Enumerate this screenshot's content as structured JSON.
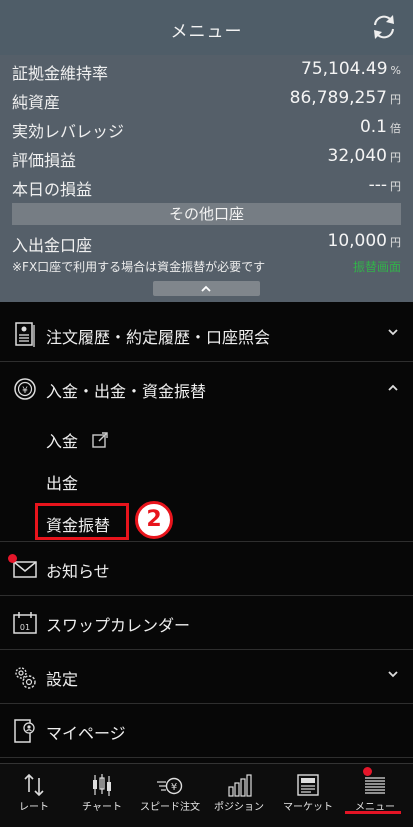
{
  "header": {
    "title": "メニュー",
    "refresh_icon": "refresh-icon"
  },
  "summary": {
    "rows": [
      {
        "label": "証拠金維持率",
        "value": "75,104.49",
        "unit": "%"
      },
      {
        "label": "純資産",
        "value": "86,789,257",
        "unit": "円"
      },
      {
        "label": "実効レバレッジ",
        "value": "0.1",
        "unit": "倍"
      },
      {
        "label": "評価損益",
        "value": "32,040",
        "unit": "円"
      },
      {
        "label": "本日の損益",
        "value": "---",
        "unit": "円"
      }
    ],
    "other_account_header": "その他口座",
    "deposit_account": {
      "label": "入出金口座",
      "value": "10,000",
      "unit": "円"
    },
    "note": "※FX口座で利用する場合は資金振替が必要です",
    "transfer_link": "振替画面",
    "collapse_icon": "chevron-up-icon"
  },
  "menu": {
    "items": [
      {
        "label": "注文履歴・約定履歴・口座照会",
        "icon": "document-list-icon"
      },
      {
        "label": "入金・出金・資金振替",
        "icon": "yen-coin-icon",
        "expanded": true
      },
      {
        "label": "お知らせ",
        "icon": "mail-icon",
        "has_notification": true
      },
      {
        "label": "スワップカレンダー",
        "icon": "calendar-icon"
      },
      {
        "label": "設定",
        "icon": "gear-icon"
      },
      {
        "label": "マイページ",
        "icon": "mypage-icon"
      }
    ],
    "submenu": [
      {
        "label": "入金",
        "icon": "external-link-icon"
      },
      {
        "label": "出金"
      },
      {
        "label": "資金振替",
        "highlighted": true
      }
    ],
    "callout_number": "2"
  },
  "tabbar": {
    "tabs": [
      {
        "label": "レート",
        "icon": "rate-arrows-icon"
      },
      {
        "label": "チャート",
        "icon": "candlestick-icon"
      },
      {
        "label": "スピード注文",
        "icon": "speed-order-icon"
      },
      {
        "label": "ポジション",
        "icon": "bar-chart-icon"
      },
      {
        "label": "マーケット",
        "icon": "news-icon"
      },
      {
        "label": "メニュー",
        "icon": "menu-list-icon",
        "active": true
      }
    ]
  },
  "colors": {
    "accent_red": "#e8141c",
    "link_green": "#33b24a",
    "header_bg": "#4f5d68",
    "panel_bg": "#555f69"
  }
}
